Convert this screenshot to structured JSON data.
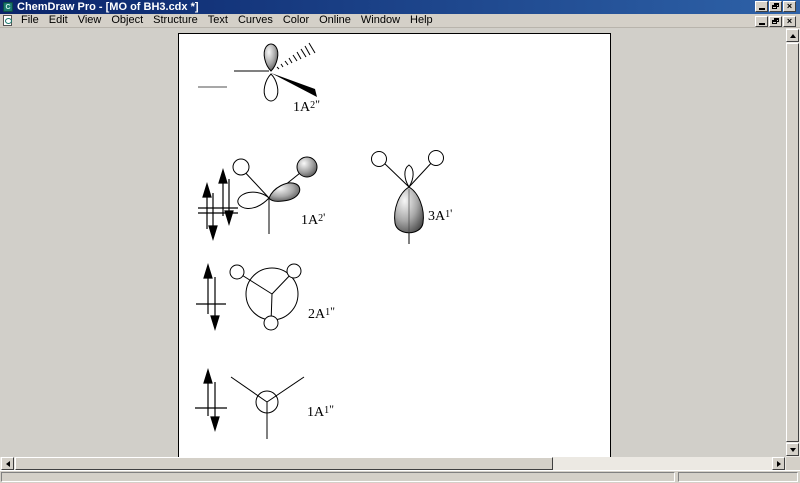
{
  "window": {
    "title": "ChemDraw Pro - [MO of BH3.cdx *]"
  },
  "icons": {
    "app_logo_letter": "C",
    "close": "×"
  },
  "menu": {
    "items": [
      "File",
      "Edit",
      "View",
      "Object",
      "Structure",
      "Text",
      "Curves",
      "Color",
      "Online",
      "Window",
      "Help"
    ]
  },
  "document": {
    "description": "Molecular orbital diagrams of BH3 drawn on a white page",
    "orbitals": [
      {
        "name": "mo-1a2-doubleprime",
        "label": {
          "pre": "1A",
          "digit": "2",
          "prime": "\""
        }
      },
      {
        "name": "mo-1a2-prime",
        "label": {
          "pre": "1A",
          "digit": "2",
          "prime": "'"
        }
      },
      {
        "name": "mo-3a1-prime",
        "label": {
          "pre": "3A",
          "digit": "1",
          "prime": "'"
        }
      },
      {
        "name": "mo-2a1-doubleprime",
        "label": {
          "pre": "2A",
          "digit": "1",
          "prime": "\""
        }
      },
      {
        "name": "mo-1a1-doubleprime",
        "label": {
          "pre": "1A",
          "digit": "1",
          "prime": "\""
        }
      }
    ]
  },
  "colors": {
    "titlebar_left": "#0a246a",
    "titlebar_right": "#2e62a8",
    "chrome_gray": "#d4d0c8",
    "workspace_gray": "#d1cfc9",
    "page_white": "#ffffff",
    "ink": "#000000",
    "lobe_shade_dark": "#4a4a4a",
    "app_icon_teal": "#1b7a6e"
  }
}
